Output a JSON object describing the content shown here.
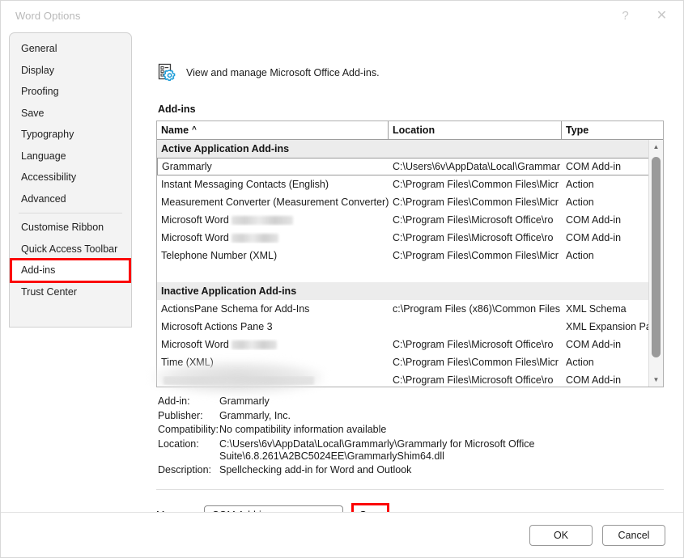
{
  "window": {
    "title": "Word Options",
    "help_label": "?",
    "close_label": "✕"
  },
  "sidebar": {
    "items": [
      {
        "label": "General",
        "highlighted": false
      },
      {
        "label": "Display",
        "highlighted": false
      },
      {
        "label": "Proofing",
        "highlighted": false
      },
      {
        "label": "Save",
        "highlighted": false
      },
      {
        "label": "Typography",
        "highlighted": false
      },
      {
        "label": "Language",
        "highlighted": false
      },
      {
        "label": "Accessibility",
        "highlighted": false
      },
      {
        "label": "Advanced",
        "highlighted": false
      },
      {
        "label": "Customise Ribbon",
        "highlighted": false
      },
      {
        "label": "Quick Access Toolbar",
        "highlighted": false
      },
      {
        "label": "Add-ins",
        "highlighted": true
      },
      {
        "label": "Trust Center",
        "highlighted": false
      }
    ]
  },
  "pane": {
    "icon_name": "addins-gear-icon",
    "header_text": "View and manage Microsoft Office Add-ins.",
    "section_label": "Add-ins"
  },
  "list": {
    "columns": [
      {
        "key": "name",
        "label": "Name",
        "sort_caret": "^"
      },
      {
        "key": "location",
        "label": "Location",
        "sort_caret": ""
      },
      {
        "key": "type",
        "label": "Type",
        "sort_caret": ""
      }
    ],
    "groups": [
      {
        "title": "Active Application Add-ins",
        "rows": [
          {
            "name": "Grammarly",
            "redact_width": 0,
            "location": "C:\\Users\\6v\\AppData\\Local\\Grammar",
            "type": "COM Add-in",
            "selected": true
          },
          {
            "name": "Instant Messaging Contacts (English)",
            "redact_width": 0,
            "location": "C:\\Program Files\\Common Files\\Micr",
            "type": "Action",
            "selected": false
          },
          {
            "name": "Measurement Converter (Measurement Converter)",
            "redact_width": 0,
            "location": "C:\\Program Files\\Common Files\\Micr",
            "type": "Action",
            "selected": false
          },
          {
            "name": "Microsoft Word",
            "redact_width": 76,
            "location": "C:\\Program Files\\Microsoft Office\\ro",
            "type": "COM Add-in",
            "selected": false
          },
          {
            "name": "Microsoft Word",
            "redact_width": 58,
            "location": "C:\\Program Files\\Microsoft Office\\ro",
            "type": "COM Add-in",
            "selected": false
          },
          {
            "name": "Telephone Number (XML)",
            "redact_width": 0,
            "location": "C:\\Program Files\\Common Files\\Micr",
            "type": "Action",
            "selected": false
          }
        ]
      },
      {
        "title": "Inactive Application Add-ins",
        "rows": [
          {
            "name": "ActionsPane Schema for Add-Ins",
            "redact_width": 0,
            "location": "c:\\Program Files (x86)\\Common Files",
            "type": "XML Schema",
            "selected": false
          },
          {
            "name": "Microsoft Actions Pane 3",
            "redact_width": 0,
            "location": "",
            "type": "XML Expansion Pack",
            "selected": false
          },
          {
            "name": "Microsoft Word",
            "redact_width": 56,
            "location": "C:\\Program Files\\Microsoft Office\\ro",
            "type": "COM Add-in",
            "selected": false
          },
          {
            "name": "Time (XML)",
            "redact_width": 0,
            "location": "C:\\Program Files\\Common Files\\Micr",
            "type": "Action",
            "selected": false
          },
          {
            "name": "",
            "redact_width": 186,
            "location": "C:\\Program Files\\Microsoft Office\\ro",
            "type": "COM Add-in",
            "selected": false
          }
        ]
      }
    ],
    "scrollbar": {
      "up_arrow": "▲",
      "down_arrow": "▼"
    }
  },
  "details": {
    "rows": [
      {
        "label": "Add-in:",
        "value": "Grammarly"
      },
      {
        "label": "Publisher:",
        "value": "Grammarly, Inc."
      },
      {
        "label": "Compatibility:",
        "value": "No compatibility information available"
      },
      {
        "label": "Location:",
        "value": "C:\\Users\\6v\\AppData\\Local\\Grammarly\\Grammarly for Microsoft Office Suite\\6.8.261\\A2BC5024EE\\GrammarlyShim64.dll"
      },
      {
        "label": "Description:",
        "value": "Spellchecking add-in for Word and Outlook"
      }
    ]
  },
  "manage": {
    "label_pre": "M",
    "label_accel": "a",
    "label_post": "nage:",
    "selected_option": "COM Add-ins",
    "caret": "⌄",
    "options": [
      "COM Add-ins"
    ],
    "go_accel": "G",
    "go_rest": "o..."
  },
  "footer": {
    "ok_label": "OK",
    "cancel_label": "Cancel"
  },
  "colors": {
    "highlight_red": "#fb0000",
    "accent_blue": "#1a9cd8",
    "sidebar_bg": "#f3f3f3",
    "group_row_bg": "#ececec"
  }
}
